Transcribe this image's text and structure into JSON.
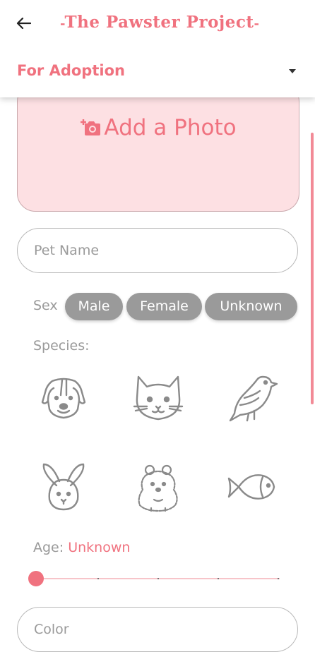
{
  "header": {
    "back_icon": "arrow-left-icon",
    "title": "The Pawster Project",
    "title_color": "#f0727f"
  },
  "listing_type": {
    "selected": "For Adoption",
    "dropdown_icon": "caret-down-icon"
  },
  "photo": {
    "label": "Add a Photo",
    "icon": "camera-add-icon",
    "background": "#fde0e3"
  },
  "form": {
    "pet_name_placeholder": "Pet Name",
    "sex_label": "Sex",
    "sex_options": [
      "Male",
      "Female",
      "Unknown"
    ],
    "species_label": "Species:",
    "species": [
      "dog-icon",
      "cat-icon",
      "bird-icon",
      "rabbit-icon",
      "hamster-icon",
      "fish-icon"
    ],
    "age_label": "Age:",
    "age_value": "Unknown",
    "age_slider_fraction": 0,
    "color_placeholder": "Color"
  },
  "colors": {
    "accent": "#f0727f",
    "chip": "#9a9a9a",
    "label_gray": "#9a9a9a"
  }
}
